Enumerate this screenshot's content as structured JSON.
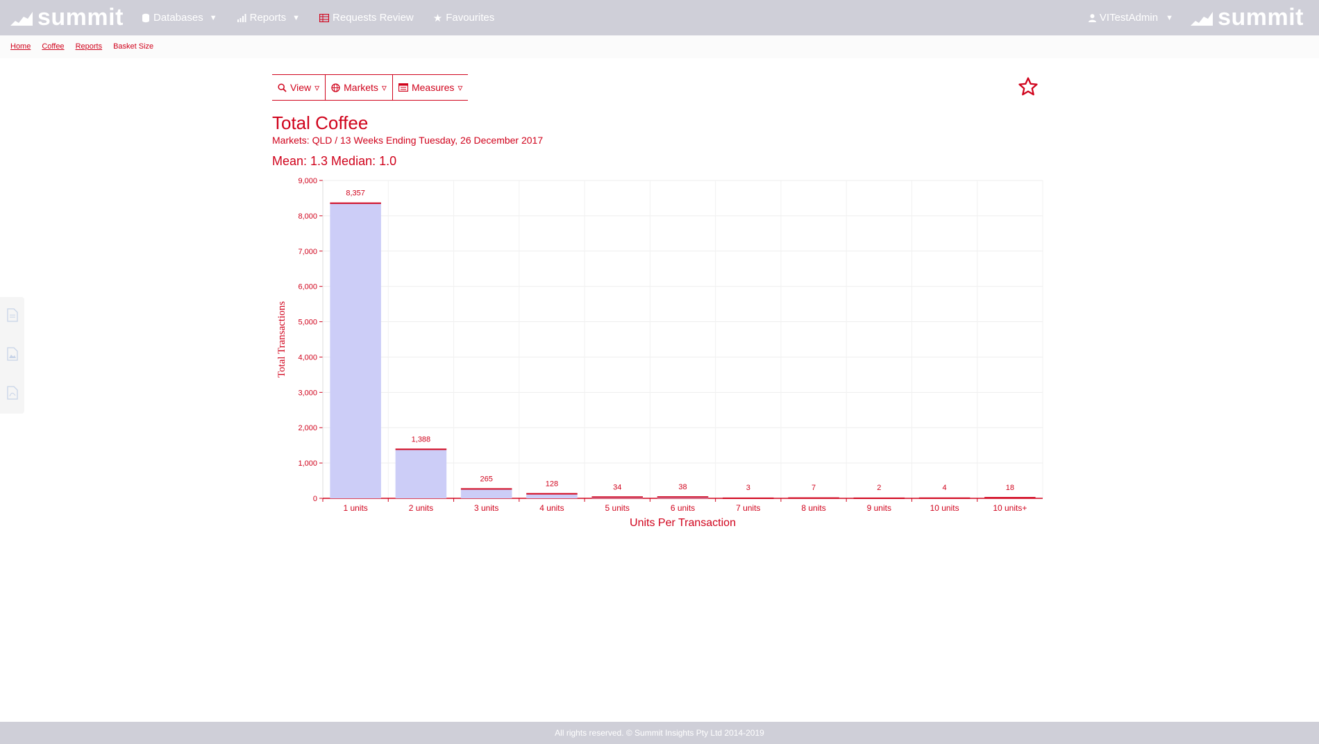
{
  "app": {
    "brand": "summit",
    "brand_right": "summit"
  },
  "nav": {
    "databases": "Databases",
    "reports": "Reports",
    "requests_review": "Requests Review",
    "favourites": "Favourites"
  },
  "user": {
    "name": "VITestAdmin"
  },
  "breadcrumb": {
    "home": "Home",
    "coffee": "Coffee",
    "reports": "Reports",
    "current": "Basket Size"
  },
  "toolbar": {
    "view": "View",
    "markets": "Markets",
    "measures": "Measures"
  },
  "report": {
    "title": "Total Coffee",
    "subtitle": "Markets: QLD / 13 Weeks Ending Tuesday, 26 December 2017",
    "stats": "Mean: 1.3 Median: 1.0"
  },
  "footer": {
    "text": "All rights reserved. © Summit Insights Pty Ltd 2014-2019"
  },
  "colors": {
    "accent": "#d0021b",
    "bar_fill": "#cccdf7",
    "topbar": "#cfcfd8"
  },
  "chart_data": {
    "type": "bar",
    "categories": [
      "1 units",
      "2 units",
      "3 units",
      "4 units",
      "5 units",
      "6 units",
      "7 units",
      "8 units",
      "9 units",
      "10 units",
      "10 units+"
    ],
    "values": [
      8357,
      1388,
      265,
      128,
      34,
      38,
      3,
      7,
      2,
      4,
      18
    ],
    "data_labels": [
      "8,357",
      "1,388",
      "265",
      "128",
      "34",
      "38",
      "3",
      "7",
      "2",
      "4",
      "18"
    ],
    "xlabel": "Units Per Transaction",
    "ylabel": "Total Transactions",
    "ylim": [
      0,
      9000
    ],
    "yticks": [
      0,
      1000,
      2000,
      3000,
      4000,
      5000,
      6000,
      7000,
      8000,
      9000
    ],
    "ytick_labels": [
      "0",
      "1,000",
      "2,000",
      "3,000",
      "4,000",
      "5,000",
      "6,000",
      "7,000",
      "8,000",
      "9,000"
    ],
    "grid": true
  }
}
